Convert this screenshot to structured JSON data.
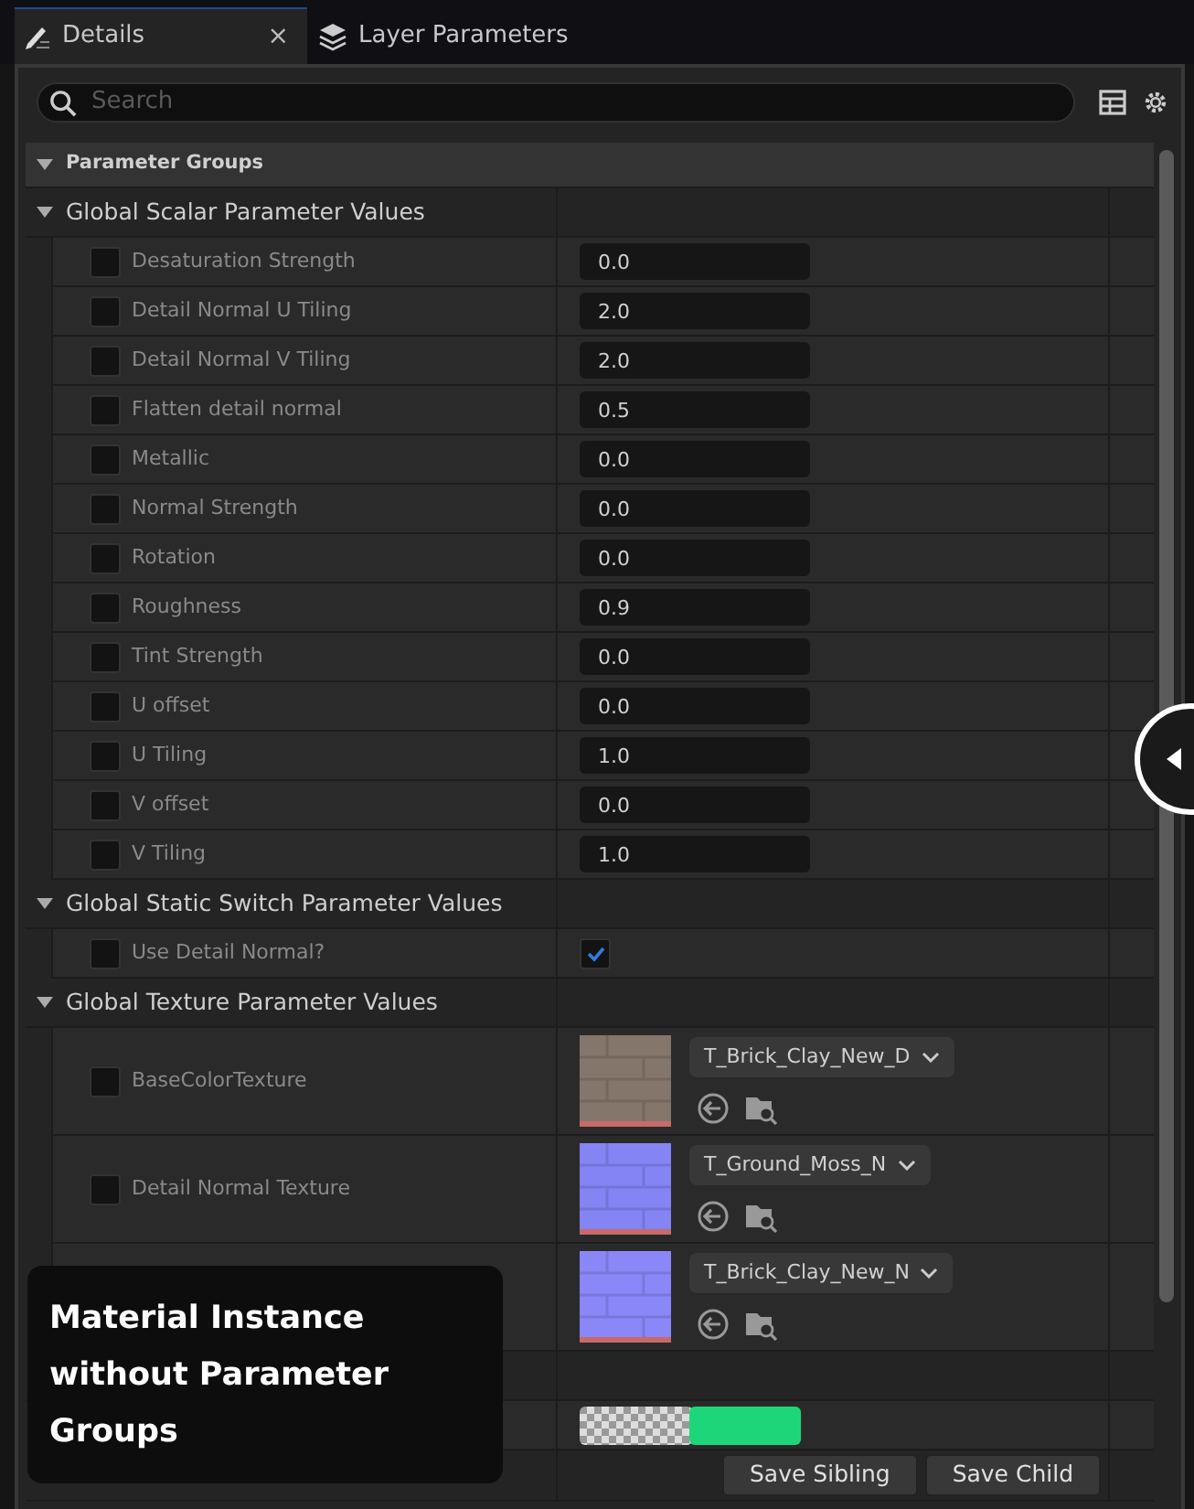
{
  "tabs": [
    {
      "label": "Details",
      "selected": true,
      "kind": "details",
      "close": "×"
    },
    {
      "label": "Layer Parameters",
      "selected": false,
      "kind": "layers"
    }
  ],
  "search": {
    "placeholder": "Search"
  },
  "category": {
    "title": "Parameter Groups",
    "expanded": true
  },
  "groups": [
    {
      "title": "Global Scalar Parameter Values",
      "expanded": true,
      "rows": [
        {
          "kind": "scalar",
          "label": "Desaturation Strength",
          "checked": false,
          "value": "0.0"
        },
        {
          "kind": "scalar",
          "label": "Detail Normal U Tiling",
          "checked": false,
          "value": "2.0"
        },
        {
          "kind": "scalar",
          "label": "Detail Normal V Tiling",
          "checked": false,
          "value": "2.0"
        },
        {
          "kind": "scalar",
          "label": "Flatten detail normal",
          "checked": false,
          "value": "0.5"
        },
        {
          "kind": "scalar",
          "label": "Metallic",
          "checked": false,
          "value": "0.0"
        },
        {
          "kind": "scalar",
          "label": "Normal Strength",
          "checked": false,
          "value": "0.0"
        },
        {
          "kind": "scalar",
          "label": "Rotation",
          "checked": false,
          "value": "0.0"
        },
        {
          "kind": "scalar",
          "label": "Roughness",
          "checked": false,
          "value": "0.9"
        },
        {
          "kind": "scalar",
          "label": "Tint Strength",
          "checked": false,
          "value": "0.0"
        },
        {
          "kind": "scalar",
          "label": "U offset",
          "checked": false,
          "value": "0.0"
        },
        {
          "kind": "scalar",
          "label": "U Tiling",
          "checked": false,
          "value": "1.0"
        },
        {
          "kind": "scalar",
          "label": "V offset",
          "checked": false,
          "value": "0.0"
        },
        {
          "kind": "scalar",
          "label": "V Tiling",
          "checked": false,
          "value": "1.0"
        }
      ]
    },
    {
      "title": "Global Static Switch Parameter Values",
      "expanded": true,
      "rows": [
        {
          "kind": "switch",
          "label": "Use Detail Normal?",
          "checked": false,
          "value_checked": true
        }
      ]
    },
    {
      "title": "Global Texture Parameter Values",
      "expanded": true,
      "rows": [
        {
          "kind": "texture",
          "label": "BaseColorTexture",
          "checked": false,
          "asset": "T_Brick_Clay_New_D",
          "color": "#85766c"
        },
        {
          "kind": "texture",
          "label": "Detail Normal Texture",
          "checked": false,
          "asset": "T_Ground_Moss_N",
          "color": "#8584f5"
        },
        {
          "kind": "texture",
          "asset": "T_Brick_Clay_New_N",
          "color": "#8a88f8"
        }
      ]
    },
    {
      "rows": [
        {
          "kind": "vector",
          "color": "#1ed67a"
        }
      ]
    }
  ],
  "buttons": [
    "Save Sibling",
    "Save Child"
  ],
  "caption": "Material Instance without Parameter Groups"
}
